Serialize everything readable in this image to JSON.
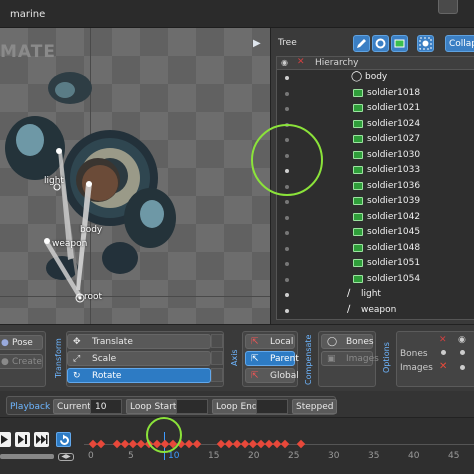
{
  "window": {
    "title": "marine"
  },
  "viewport": {
    "watermark": "MATE",
    "bone_labels": {
      "light": "light",
      "body": "body",
      "weapon": "weapon",
      "root": "root"
    }
  },
  "tree": {
    "title": "Tree",
    "collapse_label": "Collap",
    "hierarchy_label": "Hierarchy",
    "root_node": "body",
    "nodes": [
      "soldier1018",
      "soldier1021",
      "soldier1024",
      "soldier1027",
      "soldier1030",
      "soldier1033",
      "soldier1036",
      "soldier1039",
      "soldier1042",
      "soldier1045",
      "soldier1048",
      "soldier1051",
      "soldier1054"
    ],
    "bones": [
      "light",
      "weapon"
    ]
  },
  "tools": {
    "pose_label": "Pose",
    "create_label": "Create",
    "transform_title": "Transform",
    "translate_label": "Translate",
    "scale_label": "Scale",
    "rotate_label": "Rotate",
    "axis_title": "Axis",
    "local_label": "Local",
    "parent_label": "Parent",
    "global_label": "Global",
    "compensate_title": "Compensate",
    "bones_label": "Bones",
    "images_label": "Images",
    "options_title": "Options",
    "options_bones": "Bones",
    "options_images": "Images"
  },
  "playback": {
    "title": "Playback",
    "current_label": "Current",
    "current_value": "10",
    "loop_start_label": "Loop Start",
    "loop_end_label": "Loop End",
    "stepped_label": "Stepped"
  },
  "timeline": {
    "ticks": [
      "0",
      "5",
      "10",
      "15",
      "20",
      "25",
      "30",
      "35",
      "40",
      "45"
    ],
    "current_frame": 10,
    "keyframes": [
      0,
      1,
      3,
      4,
      5,
      6,
      7,
      8,
      9,
      10,
      11,
      12,
      13,
      16,
      17,
      18,
      19,
      20,
      21,
      22,
      23,
      24,
      26
    ],
    "zoom_knob": "◀▶"
  },
  "colors": {
    "accent": "#2d7bc4",
    "label_blue": "#6eb6ff",
    "key_red": "#e8483a",
    "highlight_green": "#8be33a",
    "node_green": "#2f9e3a"
  }
}
